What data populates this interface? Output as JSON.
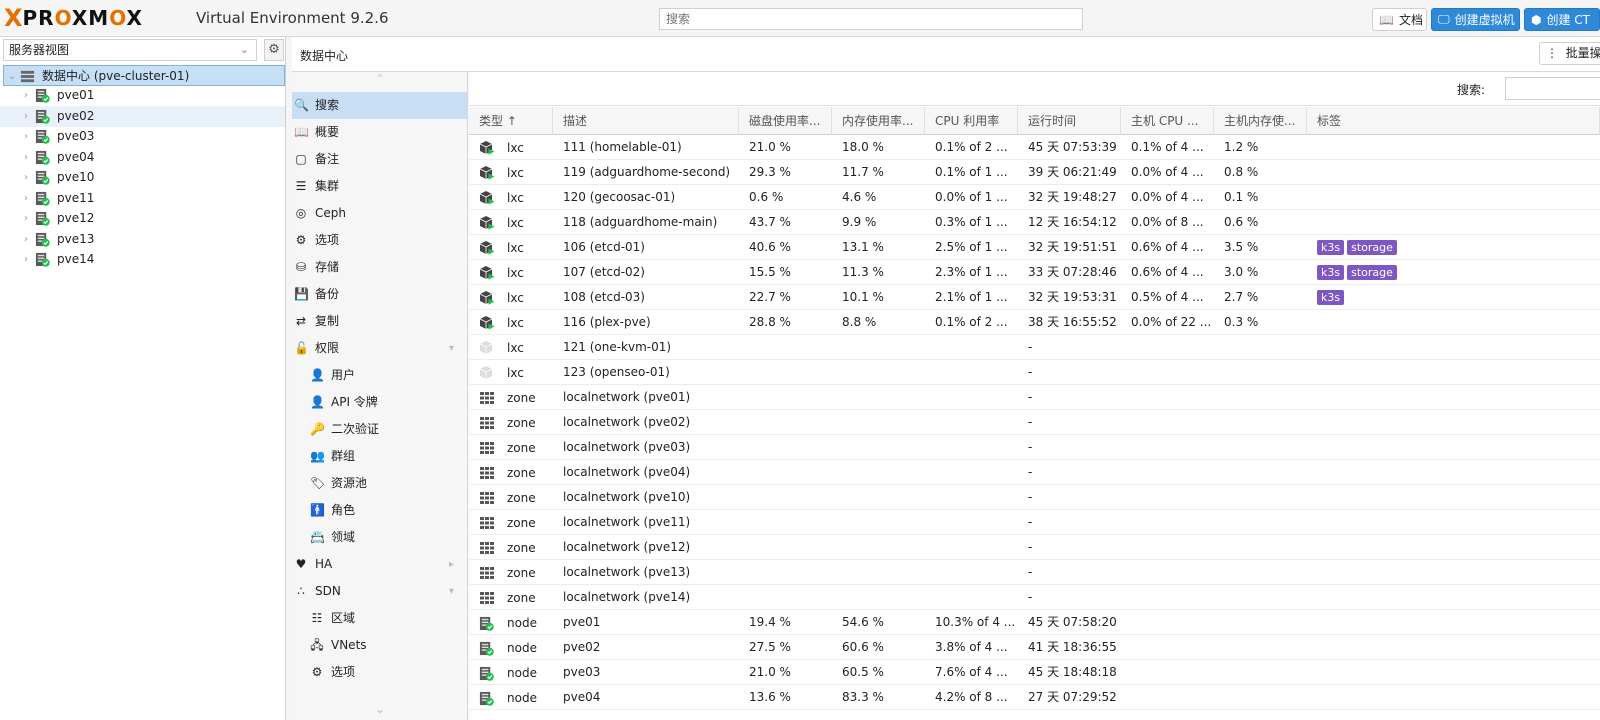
{
  "header": {
    "logo_x": "X",
    "logo_word_pre": "PR",
    "logo_word_o1": "O",
    "logo_word_mid": "XM",
    "logo_word_o2": "O",
    "logo_word_post": "X",
    "version": "Virtual Environment 9.2.6",
    "search_placeholder": "搜索",
    "docs_label": "文档",
    "create_vm_label": "创建虚拟机",
    "create_ct_label": "创建 CT"
  },
  "tree": {
    "view_label": "服务器视图",
    "root_label": "数据中心 (pve-cluster-01)",
    "nodes": [
      "pve01",
      "pve02",
      "pve03",
      "pve04",
      "pve10",
      "pve11",
      "pve12",
      "pve13",
      "pve14"
    ],
    "selected_node": "pve02"
  },
  "breadcrumb": {
    "title": "数据中心",
    "bulk_label": "批量操作"
  },
  "nav": {
    "items": [
      {
        "label": "搜索",
        "icon": "search-icon",
        "active": true
      },
      {
        "label": "概要",
        "icon": "book-icon"
      },
      {
        "label": "备注",
        "icon": "note-icon"
      },
      {
        "label": "集群",
        "icon": "server-icon"
      },
      {
        "label": "Ceph",
        "icon": "ceph-icon"
      },
      {
        "label": "选项",
        "icon": "gear-icon"
      },
      {
        "label": "存储",
        "icon": "database-icon"
      },
      {
        "label": "备份",
        "icon": "floppy-icon"
      },
      {
        "label": "复制",
        "icon": "retweet-icon"
      },
      {
        "label": "权限",
        "icon": "unlock-icon",
        "expand": "down"
      },
      {
        "label": "用户",
        "icon": "user-icon",
        "sub": true
      },
      {
        "label": "API 令牌",
        "icon": "user-outline-icon",
        "sub": true
      },
      {
        "label": "二次验证",
        "icon": "key-icon",
        "sub": true
      },
      {
        "label": "群组",
        "icon": "users-icon",
        "sub": true
      },
      {
        "label": "资源池",
        "icon": "tags-icon",
        "sub": true
      },
      {
        "label": "角色",
        "icon": "male-icon",
        "sub": true
      },
      {
        "label": "领域",
        "icon": "address-book-icon",
        "sub": true
      },
      {
        "label": "HA",
        "icon": "heartbeat-icon",
        "expand": "right"
      },
      {
        "label": "SDN",
        "icon": "sdn-icon",
        "expand": "down"
      },
      {
        "label": "区域",
        "icon": "grid-icon",
        "sub": true
      },
      {
        "label": "VNets",
        "icon": "network-icon",
        "sub": true
      },
      {
        "label": "选项",
        "icon": "gear-icon",
        "sub": true
      }
    ]
  },
  "grid": {
    "search_label": "搜索:",
    "columns": [
      "类型 ↑",
      "描述",
      "磁盘使用率...",
      "内存使用率...",
      "CPU 利用率",
      "运行时间",
      "主机 CPU ...",
      "主机内存使...",
      "标签"
    ],
    "rows": [
      {
        "icon": "lxc-running",
        "type": "lxc",
        "desc": "111 (homelable-01)",
        "disk": "21.0 %",
        "mem": "18.0 %",
        "cpu": "0.1% of 2 ...",
        "uptime": "45 天 07:53:39",
        "hcpu": "0.1% of 4 ...",
        "hmem": "1.2 %",
        "tags": []
      },
      {
        "icon": "lxc-running",
        "type": "lxc",
        "desc": "119 (adguardhome-second)",
        "disk": "29.3 %",
        "mem": "11.7 %",
        "cpu": "0.1% of 1 ...",
        "uptime": "39 天 06:21:49",
        "hcpu": "0.0% of 4 ...",
        "hmem": "0.8 %",
        "tags": []
      },
      {
        "icon": "lxc-running",
        "type": "lxc",
        "desc": "120 (gecoosac-01)",
        "disk": "0.6 %",
        "mem": "4.6 %",
        "cpu": "0.0% of 1 ...",
        "uptime": "32 天 19:48:27",
        "hcpu": "0.0% of 4 ...",
        "hmem": "0.1 %",
        "tags": []
      },
      {
        "icon": "lxc-running",
        "type": "lxc",
        "desc": "118 (adguardhome-main)",
        "disk": "43.7 %",
        "mem": "9.9 %",
        "cpu": "0.3% of 1 ...",
        "uptime": "12 天 16:54:12",
        "hcpu": "0.0% of 8 ...",
        "hmem": "0.6 %",
        "tags": []
      },
      {
        "icon": "lxc-running",
        "type": "lxc",
        "desc": "106 (etcd-01)",
        "disk": "40.6 %",
        "mem": "13.1 %",
        "cpu": "2.5% of 1 ...",
        "uptime": "32 天 19:51:51",
        "hcpu": "0.6% of 4 ...",
        "hmem": "3.5 %",
        "tags": [
          "k3s",
          "storage"
        ]
      },
      {
        "icon": "lxc-running",
        "type": "lxc",
        "desc": "107 (etcd-02)",
        "disk": "15.5 %",
        "mem": "11.3 %",
        "cpu": "2.3% of 1 ...",
        "uptime": "33 天 07:28:46",
        "hcpu": "0.6% of 4 ...",
        "hmem": "3.0 %",
        "tags": [
          "k3s",
          "storage"
        ]
      },
      {
        "icon": "lxc-running",
        "type": "lxc",
        "desc": "108 (etcd-03)",
        "disk": "22.7 %",
        "mem": "10.1 %",
        "cpu": "2.1% of 1 ...",
        "uptime": "32 天 19:53:31",
        "hcpu": "0.5% of 4 ...",
        "hmem": "2.7 %",
        "tags": [
          "k3s"
        ]
      },
      {
        "icon": "lxc-running",
        "type": "lxc",
        "desc": "116 (plex-pve)",
        "disk": "28.8 %",
        "mem": "8.8 %",
        "cpu": "0.1% of 2 ...",
        "uptime": "38 天 16:55:52",
        "hcpu": "0.0% of 22 ...",
        "hmem": "0.3 %",
        "tags": []
      },
      {
        "icon": "lxc-stopped",
        "type": "lxc",
        "desc": "121 (one-kvm-01)",
        "disk": "",
        "mem": "",
        "cpu": "",
        "uptime": "-",
        "hcpu": "",
        "hmem": "",
        "tags": []
      },
      {
        "icon": "lxc-stopped",
        "type": "lxc",
        "desc": "123 (openseo-01)",
        "disk": "",
        "mem": "",
        "cpu": "",
        "uptime": "-",
        "hcpu": "",
        "hmem": "",
        "tags": []
      },
      {
        "icon": "zone",
        "type": "zone",
        "desc": "localnetwork (pve01)",
        "disk": "",
        "mem": "",
        "cpu": "",
        "uptime": "-",
        "hcpu": "",
        "hmem": "",
        "tags": []
      },
      {
        "icon": "zone",
        "type": "zone",
        "desc": "localnetwork (pve02)",
        "disk": "",
        "mem": "",
        "cpu": "",
        "uptime": "-",
        "hcpu": "",
        "hmem": "",
        "tags": []
      },
      {
        "icon": "zone",
        "type": "zone",
        "desc": "localnetwork (pve03)",
        "disk": "",
        "mem": "",
        "cpu": "",
        "uptime": "-",
        "hcpu": "",
        "hmem": "",
        "tags": []
      },
      {
        "icon": "zone",
        "type": "zone",
        "desc": "localnetwork (pve04)",
        "disk": "",
        "mem": "",
        "cpu": "",
        "uptime": "-",
        "hcpu": "",
        "hmem": "",
        "tags": []
      },
      {
        "icon": "zone",
        "type": "zone",
        "desc": "localnetwork (pve10)",
        "disk": "",
        "mem": "",
        "cpu": "",
        "uptime": "-",
        "hcpu": "",
        "hmem": "",
        "tags": []
      },
      {
        "icon": "zone",
        "type": "zone",
        "desc": "localnetwork (pve11)",
        "disk": "",
        "mem": "",
        "cpu": "",
        "uptime": "-",
        "hcpu": "",
        "hmem": "",
        "tags": []
      },
      {
        "icon": "zone",
        "type": "zone",
        "desc": "localnetwork (pve12)",
        "disk": "",
        "mem": "",
        "cpu": "",
        "uptime": "-",
        "hcpu": "",
        "hmem": "",
        "tags": []
      },
      {
        "icon": "zone",
        "type": "zone",
        "desc": "localnetwork (pve13)",
        "disk": "",
        "mem": "",
        "cpu": "",
        "uptime": "-",
        "hcpu": "",
        "hmem": "",
        "tags": []
      },
      {
        "icon": "zone",
        "type": "zone",
        "desc": "localnetwork (pve14)",
        "disk": "",
        "mem": "",
        "cpu": "",
        "uptime": "-",
        "hcpu": "",
        "hmem": "",
        "tags": []
      },
      {
        "icon": "node",
        "type": "node",
        "desc": "pve01",
        "disk": "19.4 %",
        "mem": "54.6 %",
        "cpu": "10.3% of 4 ...",
        "uptime": "45 天 07:58:20",
        "hcpu": "",
        "hmem": "",
        "tags": []
      },
      {
        "icon": "node",
        "type": "node",
        "desc": "pve02",
        "disk": "27.5 %",
        "mem": "60.6 %",
        "cpu": "3.8% of 4 ...",
        "uptime": "41 天 18:36:55",
        "hcpu": "",
        "hmem": "",
        "tags": []
      },
      {
        "icon": "node",
        "type": "node",
        "desc": "pve03",
        "disk": "21.0 %",
        "mem": "60.5 %",
        "cpu": "7.6% of 4 ...",
        "uptime": "45 天 18:48:18",
        "hcpu": "",
        "hmem": "",
        "tags": []
      },
      {
        "icon": "node",
        "type": "node",
        "desc": "pve04",
        "disk": "13.6 %",
        "mem": "83.3 %",
        "cpu": "4.2% of 8 ...",
        "uptime": "27 天 07:29:52",
        "hcpu": "",
        "hmem": "",
        "tags": []
      }
    ]
  },
  "colors": {
    "brand_orange": "#e57000",
    "primary_blue": "#2e8ad8",
    "selection_blue": "#c6dff5",
    "tag_purple": "#7e57c2",
    "status_green": "#21bf4b"
  }
}
